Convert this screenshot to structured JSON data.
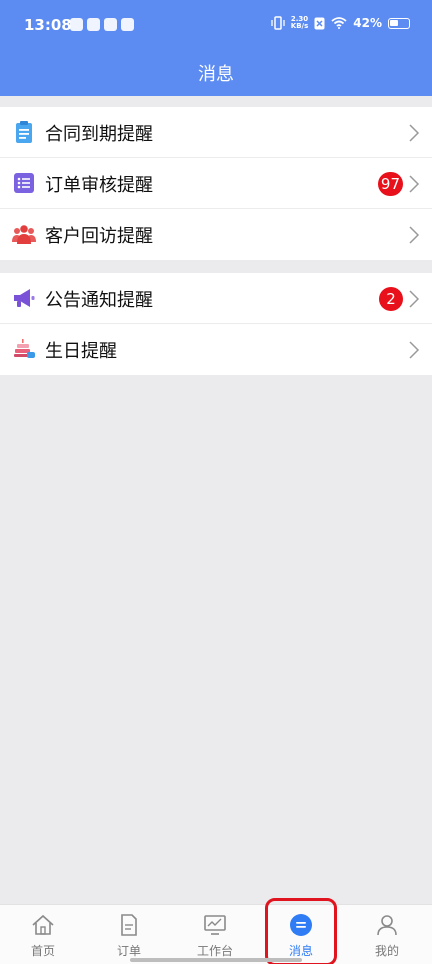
{
  "status_bar": {
    "time": "13:08",
    "net_speed_top": "2.30",
    "net_speed_bottom": "KB/s",
    "battery": "42%"
  },
  "header": {
    "title": "消息"
  },
  "groups": [
    {
      "items": [
        {
          "label": "合同到期提醒",
          "icon": "clipboard-icon",
          "badge": ""
        },
        {
          "label": "订单审核提醒",
          "icon": "list-icon",
          "badge": "97"
        },
        {
          "label": "客户回访提醒",
          "icon": "people-icon",
          "badge": ""
        }
      ]
    },
    {
      "items": [
        {
          "label": "公告通知提醒",
          "icon": "megaphone-icon",
          "badge": "2"
        },
        {
          "label": "生日提醒",
          "icon": "cake-icon",
          "badge": ""
        }
      ]
    }
  ],
  "tabbar": {
    "tabs": [
      {
        "label": "首页",
        "icon": "home-icon"
      },
      {
        "label": "订单",
        "icon": "document-icon"
      },
      {
        "label": "工作台",
        "icon": "monitor-chart-icon"
      },
      {
        "label": "消息",
        "icon": "message-icon",
        "active": true
      },
      {
        "label": "我的",
        "icon": "user-icon"
      }
    ]
  },
  "colors": {
    "header": "#5c8cf2",
    "badge": "#e8101a",
    "tab_active": "#2f7cf5",
    "highlight_box": "#e0141e"
  }
}
